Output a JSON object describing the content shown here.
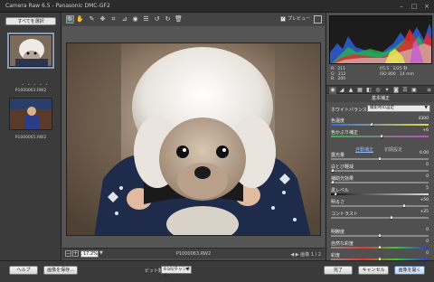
{
  "window": {
    "title": "Camera Raw 6.5  -  Panasonic DMC-GF2",
    "minimize": "–",
    "maximize": "□",
    "close": "×"
  },
  "filmstrip": {
    "select_all": "すべてを選択",
    "rating_dots": "• • • • •",
    "thumbs": [
      {
        "label": "P1000063.RW2",
        "selected": true
      },
      {
        "label": "P1000065.RW2",
        "selected": false
      }
    ]
  },
  "toolbar": {
    "tools": [
      {
        "name": "zoom-tool",
        "glyph": "🔍",
        "active": true
      },
      {
        "name": "hand-tool",
        "glyph": "✋",
        "active": false
      },
      {
        "name": "white-balance-tool",
        "glyph": "✎",
        "active": false
      },
      {
        "name": "color-sampler-tool",
        "glyph": "✥",
        "active": false
      },
      {
        "name": "crop-tool",
        "glyph": "⌗",
        "active": false
      },
      {
        "name": "straighten-tool",
        "glyph": "⊿",
        "active": false
      },
      {
        "name": "redeye-tool",
        "glyph": "◉",
        "active": false
      },
      {
        "name": "preferences-tool",
        "glyph": "☰",
        "active": false
      },
      {
        "name": "rotate-left-tool",
        "glyph": "↺",
        "active": false
      },
      {
        "name": "rotate-right-tool",
        "glyph": "↻",
        "active": false
      },
      {
        "name": "trash-tool",
        "glyph": "🗑",
        "active": false
      }
    ],
    "preview_label": "プレビュー",
    "preview_checked": "✓"
  },
  "canvas": {
    "zoom_value": "17.2%",
    "zoom_out": "−",
    "zoom_in": "+",
    "zoom_arrow": "▼",
    "filename": "P1000063.RW2",
    "nav": "◀ ▶  画像 1 / 2"
  },
  "histogram": {
    "rgb": "R:  211\nG:  212\nB:  200",
    "camera": "f/5.5    1/25 秒\nISO 800    14 mm"
  },
  "panel": {
    "title": "基本補正",
    "menu": "≡",
    "wb_label": "ホワイトバランス:",
    "wb_value": "撮影時の設定",
    "auto": "自動補正",
    "default": "初期設定",
    "sliders_top": [
      {
        "label": "色温度",
        "value": "4300",
        "pos": 0.42,
        "track": "temp"
      },
      {
        "label": "色かぶり補正",
        "value": "+6",
        "pos": 0.52,
        "track": "tint"
      }
    ],
    "sliders": [
      {
        "label": "露光量",
        "value": "0.00",
        "pos": 0.5,
        "track": ""
      },
      {
        "label": "白とび軽減",
        "value": "0",
        "pos": 0.02,
        "track": ""
      },
      {
        "label": "補助光効果",
        "value": "0",
        "pos": 0.02,
        "track": ""
      },
      {
        "label": "黒レベル",
        "value": "5",
        "pos": 0.05,
        "track": "dark"
      },
      {
        "label": "明るさ",
        "value": "+50",
        "pos": 0.75,
        "track": ""
      },
      {
        "label": "コントラスト",
        "value": "+25",
        "pos": 0.62,
        "track": ""
      },
      {
        "label": "明瞭度",
        "value": "0",
        "pos": 0.5,
        "track": ""
      },
      {
        "label": "自然な彩度",
        "value": "0",
        "pos": 0.5,
        "track": "sat"
      },
      {
        "label": "彩度",
        "value": "0",
        "pos": 0.5,
        "track": "sat"
      }
    ]
  },
  "bottombar": {
    "help": "ヘルプ",
    "save": "画像を保存...",
    "depth_label": "ビット数:",
    "depth_value": "8 bit/チャンネル",
    "done": "完了",
    "cancel": "キャンセル",
    "open": "画像を開く"
  },
  "colors": {
    "accent": "#4d6fa8"
  }
}
